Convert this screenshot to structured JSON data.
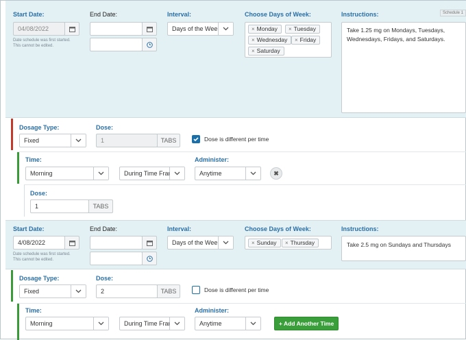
{
  "labels": {
    "start_date": "Start Date:",
    "end_date": "End Date:",
    "interval": "Interval:",
    "choose_days": "Choose Days of Week:",
    "instructions": "Instructions:",
    "dosage_type": "Dosage Type:",
    "dose": "Dose:",
    "time": "Time:",
    "administer": "Administer:",
    "dose_different": "Dose is different per time",
    "note_line1": "Date schedule was first started.",
    "note_line2": "This cannot be edited.",
    "units": "TABS"
  },
  "schedule1": {
    "badge": "Schedule 1",
    "start_date": "04/08/2022",
    "end_date": "",
    "end_time": "",
    "interval": "Days of the Week",
    "days": [
      "Monday",
      "Tuesday",
      "Wednesday",
      "Friday",
      "Saturday"
    ],
    "instructions": "Take 1.25 mg on Mondays, Tuesdays, Wednesdays, Fridays, and Saturdays.",
    "dosage_type": "Fixed",
    "dose": "1",
    "dose_different_checked": true,
    "time": "Morning",
    "time_frame": "During Time Frame",
    "administer": "Anytime",
    "time_dose": "1"
  },
  "schedule2": {
    "start_date": "4/08/2022",
    "end_date": "",
    "end_time": "",
    "interval": "Days of the Week",
    "days": [
      "Sunday",
      "Thursday"
    ],
    "instructions": "Take 2.5 mg on Sundays and Thursdays",
    "dosage_type": "Fixed",
    "dose": "2",
    "dose_different_checked": false,
    "time": "Morning",
    "time_frame": "During Time Frame",
    "administer": "Anytime",
    "add_time_label": "Add Another Time"
  },
  "colors": {
    "label_blue": "#2a6fa6",
    "schedule_bg": "#e3f0f4",
    "red_bar": "#c0392b",
    "green_bar": "#3a9a3a",
    "checkbox_blue": "#1a6fa8",
    "button_green": "#3a9e3a"
  }
}
